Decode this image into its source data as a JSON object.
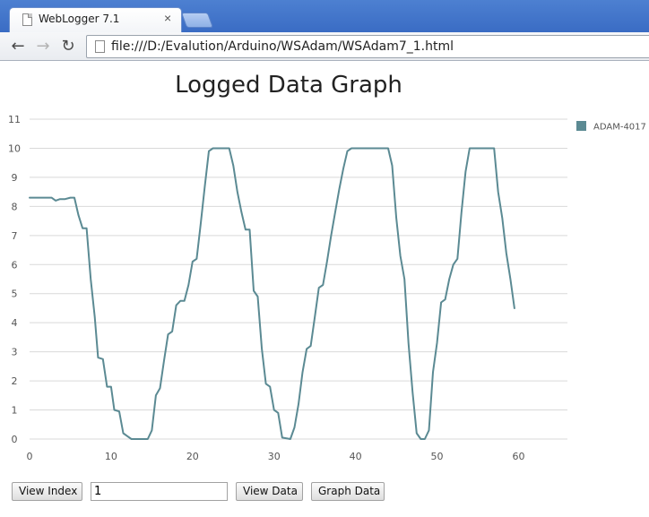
{
  "browser": {
    "tab_title": "WebLogger 7.1",
    "close_glyph": "×",
    "url": "file:///D:/Evalution/Arduino/WSAdam/WSAdam7_1.html"
  },
  "page": {
    "title": "Logged Data Graph"
  },
  "controls": {
    "view_index_label": "View Index",
    "index_value": "1",
    "view_data_label": "View Data",
    "graph_data_label": "Graph Data"
  },
  "chart_data": {
    "type": "line",
    "title": "",
    "xlabel": "",
    "ylabel": "",
    "xlim": [
      0,
      66
    ],
    "ylim": [
      0,
      11
    ],
    "x_ticks": [
      0,
      10,
      20,
      30,
      40,
      50,
      60
    ],
    "y_ticks": [
      0,
      1,
      2,
      3,
      4,
      5,
      6,
      7,
      8,
      9,
      10,
      11
    ],
    "grid": true,
    "legend_position": "top-right",
    "series": [
      {
        "name": "ADAM-4017",
        "color": "#5b8a93",
        "points": [
          [
            0,
            8.3
          ],
          [
            1,
            8.3
          ],
          [
            2,
            8.3
          ],
          [
            2.7,
            8.3
          ],
          [
            3.2,
            8.2
          ],
          [
            3.7,
            8.25
          ],
          [
            4.3,
            8.25
          ],
          [
            5,
            8.3
          ],
          [
            5.5,
            8.3
          ],
          [
            6,
            7.7
          ],
          [
            6.5,
            7.25
          ],
          [
            7,
            7.25
          ],
          [
            7.5,
            5.5
          ],
          [
            8,
            4.2
          ],
          [
            8.4,
            2.8
          ],
          [
            9,
            2.75
          ],
          [
            9.5,
            1.8
          ],
          [
            10,
            1.8
          ],
          [
            10.4,
            1
          ],
          [
            11,
            0.95
          ],
          [
            11.5,
            0.2
          ],
          [
            12,
            0.1
          ],
          [
            12.5,
            0
          ],
          [
            13.5,
            0
          ],
          [
            14.5,
            0
          ],
          [
            15,
            0.3
          ],
          [
            15.5,
            1.5
          ],
          [
            16,
            1.75
          ],
          [
            16.5,
            2.7
          ],
          [
            17,
            3.6
          ],
          [
            17.5,
            3.7
          ],
          [
            18,
            4.6
          ],
          [
            18.5,
            4.75
          ],
          [
            19,
            4.75
          ],
          [
            19.5,
            5.3
          ],
          [
            20,
            6.1
          ],
          [
            20.5,
            6.2
          ],
          [
            21,
            7.4
          ],
          [
            21.5,
            8.7
          ],
          [
            22,
            9.9
          ],
          [
            22.5,
            10
          ],
          [
            23.5,
            10
          ],
          [
            24.5,
            10
          ],
          [
            25,
            9.4
          ],
          [
            25.5,
            8.5
          ],
          [
            26,
            7.8
          ],
          [
            26.5,
            7.2
          ],
          [
            27,
            7.2
          ],
          [
            27.5,
            5.1
          ],
          [
            28,
            4.9
          ],
          [
            28.5,
            3.1
          ],
          [
            29,
            1.9
          ],
          [
            29.5,
            1.8
          ],
          [
            30,
            1
          ],
          [
            30.5,
            0.9
          ],
          [
            31,
            0.05
          ],
          [
            32,
            0
          ],
          [
            32.5,
            0.4
          ],
          [
            33,
            1.2
          ],
          [
            33.5,
            2.3
          ],
          [
            34,
            3.1
          ],
          [
            34.5,
            3.2
          ],
          [
            35,
            4.2
          ],
          [
            35.5,
            5.2
          ],
          [
            36,
            5.3
          ],
          [
            36.5,
            6.1
          ],
          [
            37,
            7
          ],
          [
            37.5,
            7.8
          ],
          [
            38,
            8.6
          ],
          [
            38.5,
            9.3
          ],
          [
            39,
            9.9
          ],
          [
            39.5,
            10
          ],
          [
            41,
            10
          ],
          [
            43,
            10
          ],
          [
            44,
            10
          ],
          [
            44.5,
            9.4
          ],
          [
            45,
            7.6
          ],
          [
            45.5,
            6.3
          ],
          [
            46,
            5.5
          ],
          [
            46.5,
            3.3
          ],
          [
            47,
            1.6
          ],
          [
            47.5,
            0.2
          ],
          [
            48,
            0
          ],
          [
            48.5,
            0
          ],
          [
            49,
            0.3
          ],
          [
            49.5,
            2.3
          ],
          [
            50,
            3.3
          ],
          [
            50.5,
            4.7
          ],
          [
            51,
            4.8
          ],
          [
            51.5,
            5.5
          ],
          [
            52,
            6
          ],
          [
            52.5,
            6.2
          ],
          [
            53,
            7.8
          ],
          [
            53.5,
            9.2
          ],
          [
            54,
            10
          ],
          [
            55,
            10
          ],
          [
            56,
            10
          ],
          [
            57,
            10
          ],
          [
            57.5,
            8.5
          ],
          [
            58,
            7.6
          ],
          [
            58.5,
            6.4
          ],
          [
            59,
            5.5
          ],
          [
            59.5,
            4.5
          ]
        ]
      }
    ]
  }
}
